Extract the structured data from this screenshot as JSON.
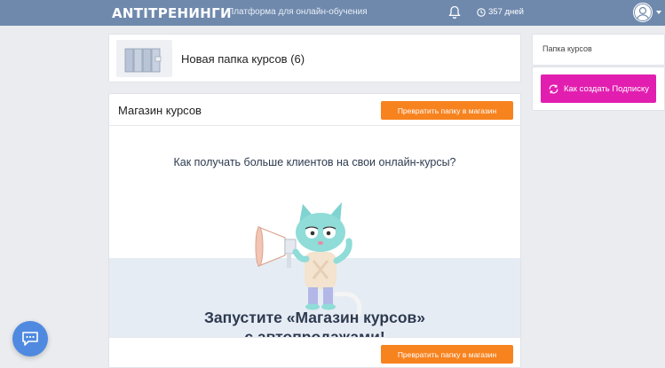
{
  "topbar": {
    "logo": "ANTITРЕНИНГИ",
    "tagline": "Платформа для онлайн-обучения",
    "days": "357 дней",
    "icons": {
      "bell": "bell-icon",
      "clock": "clock-icon",
      "avatar": "user-avatar-icon"
    }
  },
  "folder": {
    "title": "Новая папка курсов (6)"
  },
  "store": {
    "title": "Магазин курсов",
    "convert_button": "Превратить папку в магазин",
    "question": "Как получать больше клиентов на свои онлайн-курсы?",
    "headline_line1": "Запустите «Магазин курсов»",
    "headline_line2": "с автопродажами!",
    "convert_button_bottom": "Превратить папку в магазин"
  },
  "sidebar": {
    "folder_label": "Папка курсов",
    "subscription_button": "Как создать Подписку"
  },
  "colors": {
    "topbar": "#6f89ad",
    "accent_orange": "#f7831f",
    "accent_pink": "#e21eb0",
    "chat": "#4f8ae0"
  }
}
